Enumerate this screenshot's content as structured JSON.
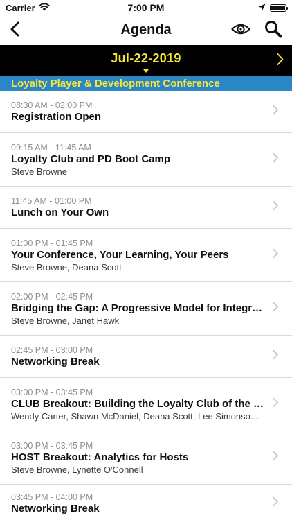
{
  "status_bar": {
    "carrier": "Carrier",
    "time": "7:00 PM",
    "battery_level": 1.0
  },
  "nav": {
    "title": "Agenda",
    "icons": [
      "back-arrow-icon",
      "eye-icon",
      "search-icon"
    ]
  },
  "date_selector": {
    "date": "Jul-22-2019",
    "accent_color": "#f6e53a",
    "background_color": "#000000"
  },
  "conference": {
    "name": "Loyalty Player & Development Conference",
    "background_color": "#2b86c5"
  },
  "agenda": {
    "items": [
      {
        "time": "08:30 AM - 02:00 PM",
        "title": "Registration Open",
        "speakers": ""
      },
      {
        "time": "09:15 AM - 11:45 AM",
        "title": "Loyalty Club and PD Boot Camp",
        "speakers": "Steve Browne"
      },
      {
        "time": "11:45 AM - 01:00 PM",
        "title": "Lunch on Your Own",
        "speakers": ""
      },
      {
        "time": "01:00 PM - 01:45 PM",
        "title": "Your Conference, Your Learning, Your Peers",
        "speakers": "Steve Browne, Deana Scott"
      },
      {
        "time": "02:00 PM - 02:45 PM",
        "title": "Bridging the Gap: A Progressive Model for Integrati...",
        "speakers": "Steve Browne, Janet Hawk"
      },
      {
        "time": "02:45 PM - 03:00 PM",
        "title": "Networking Break",
        "speakers": ""
      },
      {
        "time": "03:00 PM - 03:45 PM",
        "title": "CLUB Breakout: Building the Loyalty Club of the Fut...",
        "speakers": "Wendy Carter, Shawn McDaniel, Deana Scott, Lee Simonson, L..."
      },
      {
        "time": "03:00 PM - 03:45 PM",
        "title": "HOST Breakout: Analytics for Hosts",
        "speakers": "Steve Browne, Lynette O'Connell"
      },
      {
        "time": "03:45 PM - 04:00 PM",
        "title": "Networking Break",
        "speakers": ""
      }
    ]
  }
}
